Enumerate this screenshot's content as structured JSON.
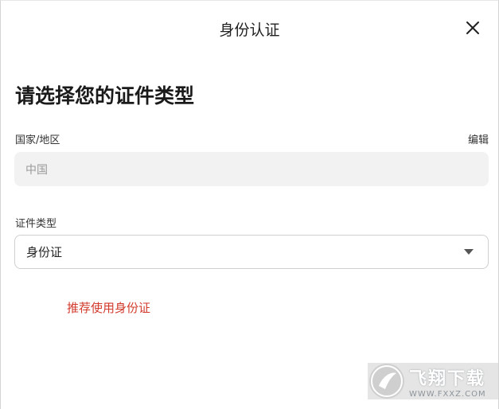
{
  "header": {
    "title": "身份认证",
    "close_icon": "close-icon"
  },
  "main": {
    "heading": "请选择您的证件类型",
    "country": {
      "label": "国家/地区",
      "edit_label": "编辑",
      "value": "中国"
    },
    "id_type": {
      "label": "证件类型",
      "selected": "身份证",
      "caret_icon": "caret-down-icon"
    },
    "recommendation": "推荐使用身份证"
  },
  "watermark": {
    "main_text": "飞翔下载",
    "sub_text": "WWW.FXXZ.COM"
  },
  "colors": {
    "recommend_text": "#d23a2c",
    "field_disabled_bg": "#f2f2f2",
    "border": "#cfcfcf"
  }
}
